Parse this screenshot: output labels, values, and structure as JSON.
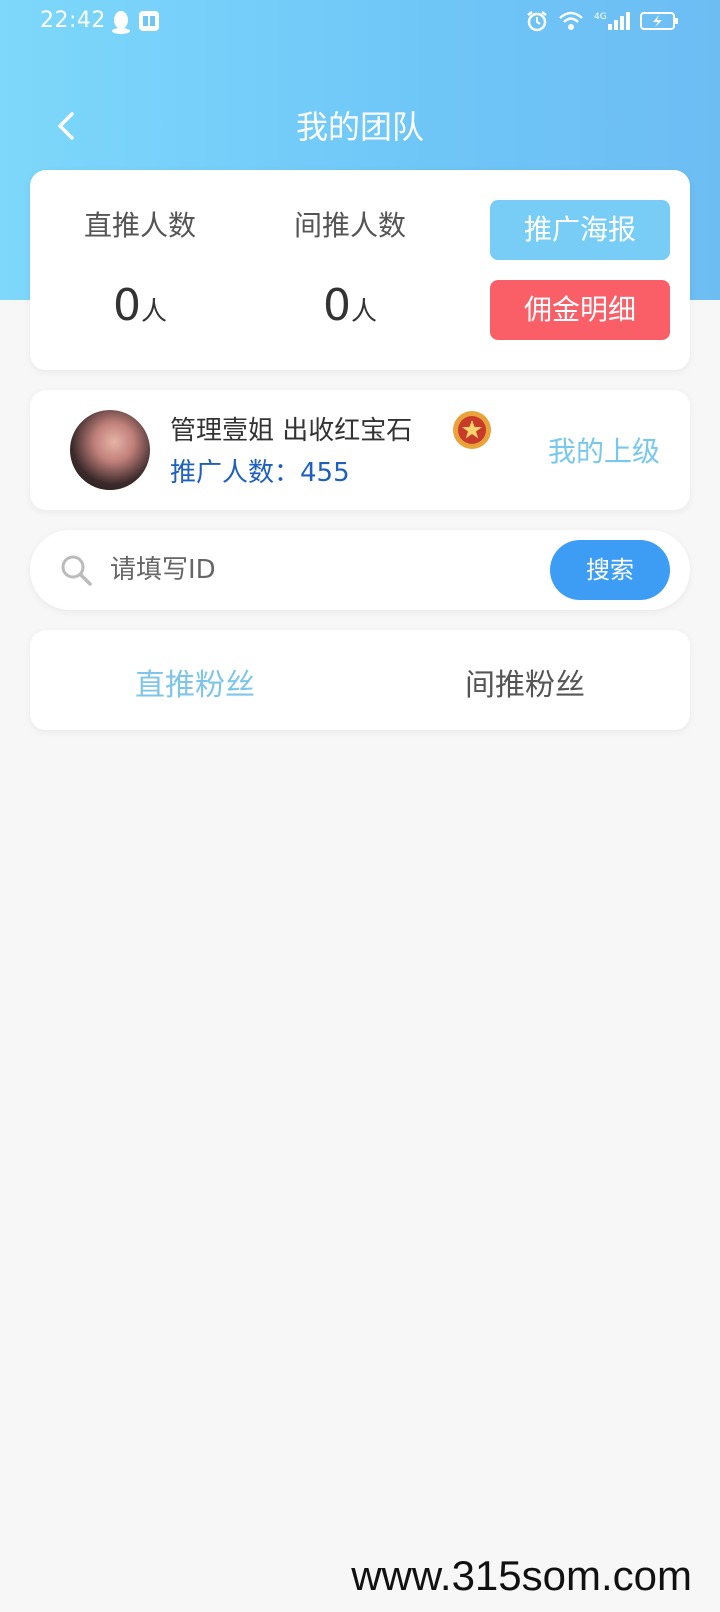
{
  "status_bar": {
    "time": "22:42",
    "icons_left": [
      "qq-icon",
      "reader-icon"
    ],
    "icons_right": [
      "alarm-icon",
      "wifi-icon",
      "signal-4g-icon",
      "battery-charging-icon"
    ]
  },
  "nav": {
    "title": "我的团队"
  },
  "stats": {
    "direct_label": "直推人数",
    "direct_value": "0",
    "direct_unit": "人",
    "indirect_label": "间推人数",
    "indirect_value": "0",
    "indirect_unit": "人",
    "poster_button": "推广海报",
    "commission_button": "佣金明细"
  },
  "upline": {
    "name": "管理壹姐 出收红宝石",
    "count_label": "推广人数：",
    "count_value": "455",
    "link_label": "我的上级"
  },
  "search": {
    "placeholder": "请填写ID",
    "value": "",
    "button_label": "搜索"
  },
  "tabs": [
    {
      "label": "直推粉丝",
      "active": true
    },
    {
      "label": "间推粉丝",
      "active": false
    }
  ],
  "watermark": "www.315som.com",
  "colors": {
    "header_gradient_start": "#7dd8fb",
    "header_gradient_end": "#6dbdf3",
    "poster_button": "#78cdf7",
    "commission_button": "#fa5f67",
    "search_button": "#3d9df5",
    "active_tab": "#7ec6e9",
    "count_text": "#1f5fc0"
  }
}
